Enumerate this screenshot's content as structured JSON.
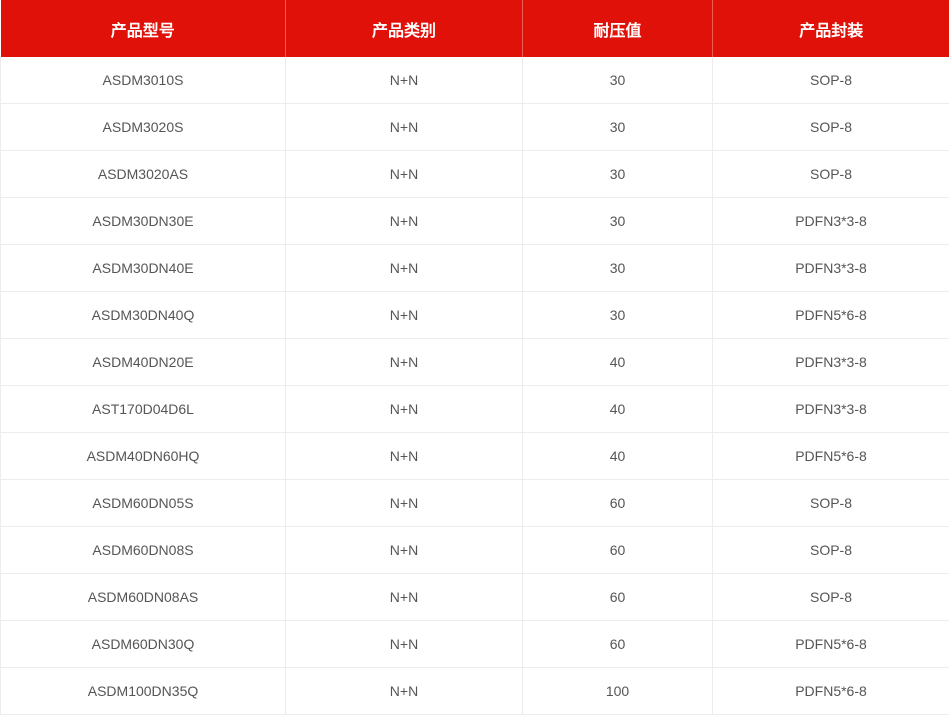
{
  "accent_color": "#e01109",
  "table": {
    "headers": [
      "产品型号",
      "产品类别",
      "耐压值",
      "产品封装"
    ],
    "rows": [
      [
        "ASDM3010S",
        "N+N",
        "30",
        "SOP-8"
      ],
      [
        "ASDM3020S",
        "N+N",
        "30",
        "SOP-8"
      ],
      [
        "ASDM3020AS",
        "N+N",
        "30",
        "SOP-8"
      ],
      [
        "ASDM30DN30E",
        "N+N",
        "30",
        "PDFN3*3-8"
      ],
      [
        "ASDM30DN40E",
        "N+N",
        "30",
        "PDFN3*3-8"
      ],
      [
        "ASDM30DN40Q",
        "N+N",
        "30",
        "PDFN5*6-8"
      ],
      [
        "ASDM40DN20E",
        "N+N",
        "40",
        "PDFN3*3-8"
      ],
      [
        "AST170D04D6L",
        "N+N",
        "40",
        "PDFN3*3-8"
      ],
      [
        "ASDM40DN60HQ",
        "N+N",
        "40",
        "PDFN5*6-8"
      ],
      [
        "ASDM60DN05S",
        "N+N",
        "60",
        "SOP-8"
      ],
      [
        "ASDM60DN08S",
        "N+N",
        "60",
        "SOP-8"
      ],
      [
        "ASDM60DN08AS",
        "N+N",
        "60",
        "SOP-8"
      ],
      [
        "ASDM60DN30Q",
        "N+N",
        "60",
        "PDFN5*6-8"
      ],
      [
        "ASDM100DN35Q",
        "N+N",
        "100",
        "PDFN5*6-8"
      ]
    ]
  }
}
